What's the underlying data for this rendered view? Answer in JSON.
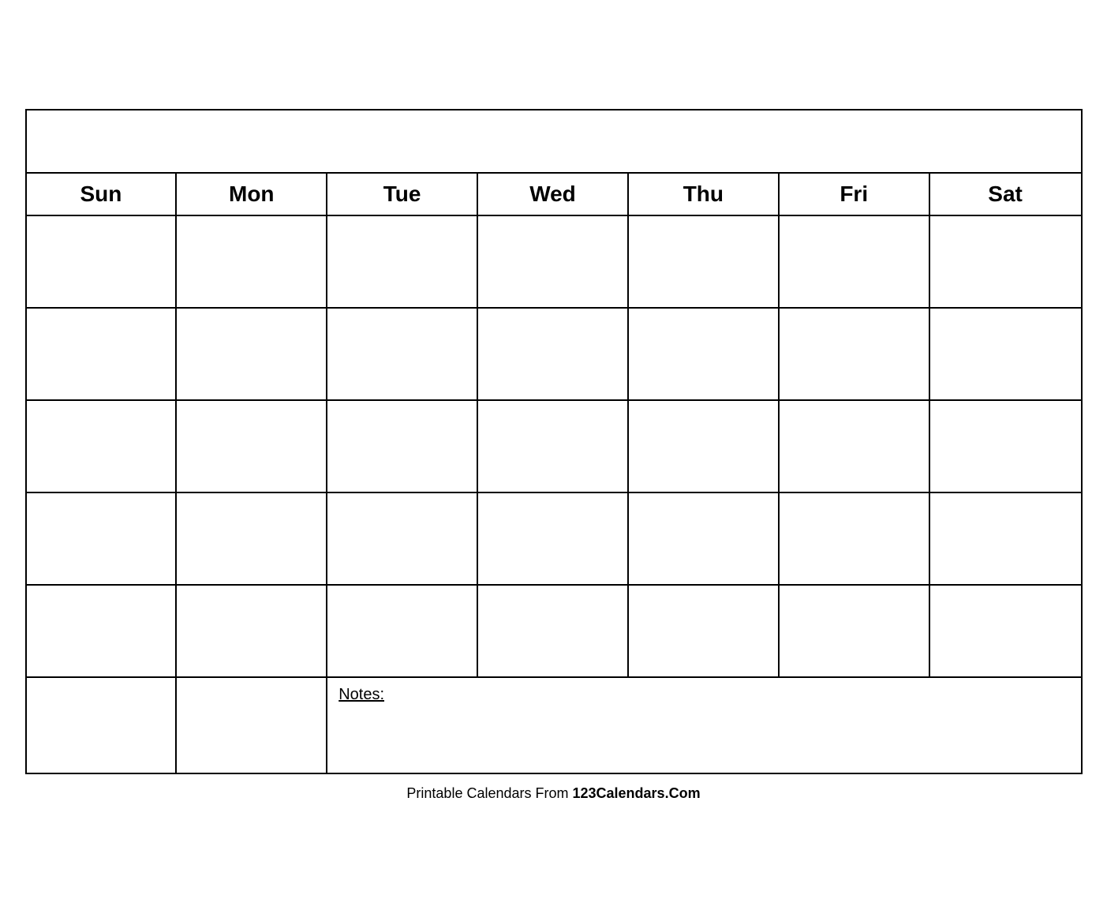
{
  "calendar": {
    "title": "",
    "days": [
      "Sun",
      "Mon",
      "Tue",
      "Wed",
      "Thu",
      "Fri",
      "Sat"
    ],
    "rows": 5,
    "notes_label": "Notes:"
  },
  "footer": {
    "text_normal": "Printable Calendars From ",
    "text_bold": "123Calendars.Com"
  }
}
